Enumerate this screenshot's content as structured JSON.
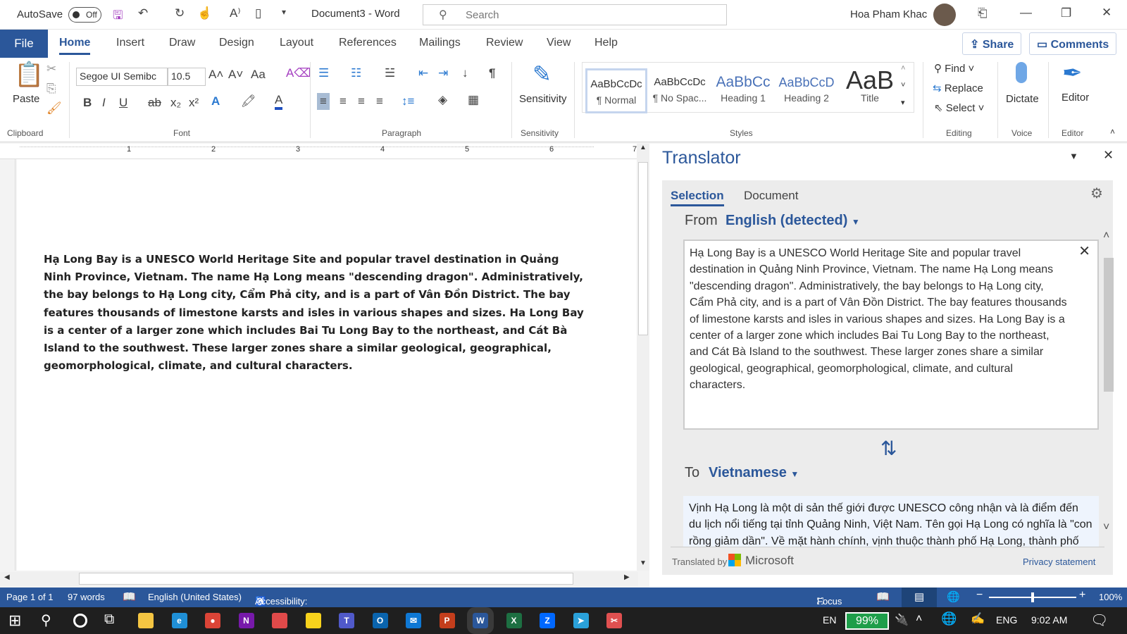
{
  "titlebar": {
    "autosave": "AutoSave",
    "autosave_state": "Off",
    "title": "Document3  -  Word",
    "search_placeholder": "Search",
    "user": "Hoa Pham Khac"
  },
  "tabs": [
    "File",
    "Home",
    "Insert",
    "Draw",
    "Design",
    "Layout",
    "References",
    "Mailings",
    "Review",
    "View",
    "Help"
  ],
  "share": "Share",
  "comments": "Comments",
  "ribbon": {
    "clipboard": {
      "label": "Clipboard",
      "paste": "Paste"
    },
    "font": {
      "label": "Font",
      "name": "Segoe UI Semibc",
      "size": "10.5"
    },
    "paragraph": {
      "label": "Paragraph"
    },
    "sensitivity": {
      "label": "Sensitivity",
      "button": "Sensitivity"
    },
    "styles": {
      "label": "Styles",
      "items": [
        {
          "sample": "AaBbCcDc",
          "name": "¶ Normal"
        },
        {
          "sample": "AaBbCcDc",
          "name": "¶ No Spac..."
        },
        {
          "sample": "AaBbCc",
          "name": "Heading 1"
        },
        {
          "sample": "AaBbCcD",
          "name": "Heading 2"
        },
        {
          "sample": "AaB",
          "name": "Title"
        }
      ]
    },
    "editing": {
      "label": "Editing",
      "find": "Find",
      "replace": "Replace",
      "select": "Select"
    },
    "voice": {
      "label": "Voice",
      "dictate": "Dictate"
    },
    "editor": {
      "label": "Editor",
      "button": "Editor"
    }
  },
  "ruler_numbers": [
    "1",
    "2",
    "3",
    "4",
    "5",
    "6",
    "7"
  ],
  "document": {
    "text": "Hạ Long Bay is a UNESCO World Heritage Site and popular travel destination in Quảng Ninh Province, Vietnam. The name Hạ Long means \"descending dragon\". Administratively, the bay belongs to Hạ Long city, Cẩm Phả city, and is a part of Vân Đồn District. The bay features thousands of limestone karsts and isles in various shapes and sizes. Ha Long Bay is a center of a larger zone which includes Bai Tu Long Bay to the northeast, and Cát Bà Island to the southwest. These larger zones share a similar geological, geographical, geomorphological, climate, and cultural characters."
  },
  "translator": {
    "title": "Translator",
    "tabs": [
      "Selection",
      "Document"
    ],
    "from_label": "From",
    "from_lang": "English (detected)",
    "source": "Hạ Long Bay is a UNESCO World Heritage Site and popular travel destination in Quảng Ninh Province, Vietnam. The name Hạ Long means \"descending dragon\". Administratively, the bay belongs to Hạ Long city, Cẩm Phả city, and is a part of Vân Đồn District. The bay features thousands of limestone karsts and isles in various shapes and sizes. Ha Long Bay is a center of a larger zone which includes Bai Tu Long Bay to the northeast, and Cát Bà Island to the southwest. These larger zones share a similar geological, geographical, geomorphological, climate, and cultural characters.",
    "to_label": "To",
    "to_lang": "Vietnamese",
    "target": "Vịnh Hạ Long là một di sản thế giới được UNESCO công nhận và là điểm đến du lịch nổi tiếng tại tỉnh Quảng Ninh, Việt Nam. Tên gọi Hạ Long có nghĩa là \"con rồng giảm dần\". Về mặt hành chính, vịnh thuộc thành phố Hạ Long, thành phố Cẩm Phả, và là một phần của quận Vân Đồn.",
    "translated_by": "Translated by",
    "microsoft": "Microsoft",
    "privacy": "Privacy statement"
  },
  "status": {
    "page": "Page 1 of 1",
    "words": "97 words",
    "language": "English (United States)",
    "accessibility": "Accessibility: Good to go",
    "focus": "Focus",
    "zoom": "100%",
    "zoom_value": 100
  },
  "taskbar": {
    "lang": "EN",
    "battery": "99%",
    "input": "ENG",
    "time": "9:02 AM",
    "apps": [
      {
        "n": "file-explorer",
        "c": "#f4c542",
        "t": ""
      },
      {
        "n": "edge",
        "c": "#1f8fd6",
        "t": "e"
      },
      {
        "n": "chrome",
        "c": "#db4437",
        "t": "●"
      },
      {
        "n": "onenote",
        "c": "#7719aa",
        "t": "N"
      },
      {
        "n": "app",
        "c": "#e04a4a",
        "t": ""
      },
      {
        "n": "sticky-notes",
        "c": "#f7d21c",
        "t": ""
      },
      {
        "n": "teams",
        "c": "#5059c9",
        "t": "T"
      },
      {
        "n": "outlook",
        "c": "#0a64ad",
        "t": "O"
      },
      {
        "n": "mail",
        "c": "#0f78d4",
        "t": "✉"
      },
      {
        "n": "powerpoint",
        "c": "#c43e1c",
        "t": "P"
      },
      {
        "n": "word",
        "c": "#2b579a",
        "t": "W"
      },
      {
        "n": "excel",
        "c": "#1d6f42",
        "t": "X"
      },
      {
        "n": "zalo",
        "c": "#0068ff",
        "t": "Z"
      },
      {
        "n": "telegram",
        "c": "#2aa1da",
        "t": "➤"
      },
      {
        "n": "snipping-tool",
        "c": "#e05050",
        "t": "✂"
      }
    ]
  },
  "colors": {
    "accent": "#2b579a",
    "battery": "#1e9e4a"
  }
}
